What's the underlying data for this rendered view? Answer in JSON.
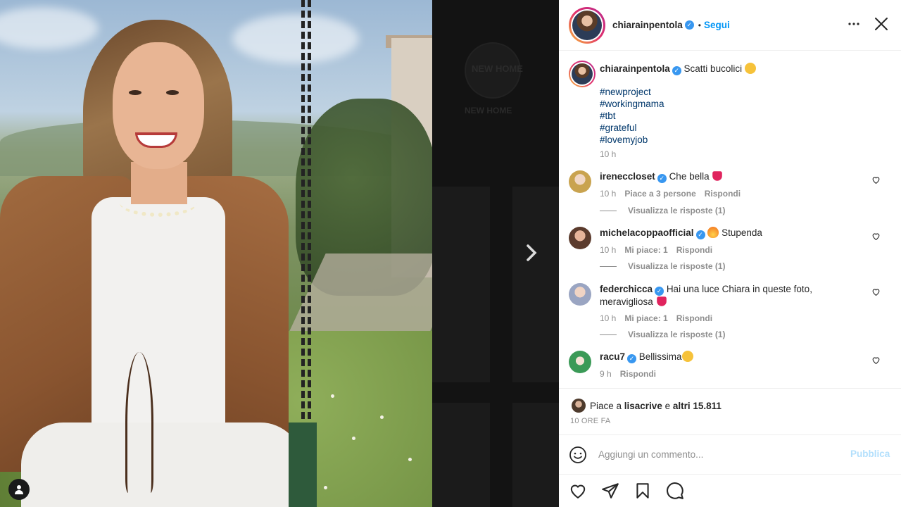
{
  "background": {
    "highlight_text": "NEW HOME",
    "highlight_label": "NEW HOME"
  },
  "header": {
    "username": "chiarainpentola",
    "verified": true,
    "separator": "•",
    "follow_label": "Segui",
    "more_icon": "ellipsis-icon",
    "close_icon": "close-icon"
  },
  "caption": {
    "username": "chiarainpentola",
    "text": "Scatti bucolici",
    "emoji": "star-struck",
    "hashtags": [
      "#newproject",
      "#workingmama",
      "#tbt",
      "#grateful",
      "#lovemyjob"
    ],
    "time": "10 h"
  },
  "comments": [
    {
      "username": "ireneccloset",
      "verified": true,
      "text": "Che bella",
      "emoji": "red-heart",
      "time": "10 h",
      "likes": "Piace a 3 persone",
      "reply_label": "Rispondi",
      "view_replies": "Visualizza le risposte (1)"
    },
    {
      "username": "michelacoppaofficial",
      "verified": true,
      "emoji": "fire",
      "text": "Stupenda",
      "time": "10 h",
      "likes": "Mi piace: 1",
      "reply_label": "Rispondi",
      "view_replies": "Visualizza le risposte (1)"
    },
    {
      "username": "federchicca",
      "verified": true,
      "text_line1": "Hai una luce Chiara in queste foto,",
      "text_line2": "meravigliosa",
      "emoji": "red-heart",
      "time": "10 h",
      "likes": "Mi piace: 1",
      "reply_label": "Rispondi",
      "view_replies": "Visualizza le risposte (1)"
    },
    {
      "username": "racu7",
      "verified": true,
      "text": "Bellissima",
      "emoji": "heart-eyes",
      "time": "9 h",
      "reply_label": "Rispondi"
    }
  ],
  "likes": {
    "prefix": "Piace a ",
    "user": "lisacrive",
    "middle": " e ",
    "others": "altri 15.811"
  },
  "date": "10 ORE FA",
  "add_comment": {
    "placeholder": "Aggiungi un commento...",
    "publish_label": "Pubblica"
  },
  "actions": [
    "heart-icon",
    "share-icon",
    "bookmark-icon",
    "comment-icon"
  ],
  "colors": {
    "link_blue": "#0095f6",
    "hashtag": "#00376b",
    "verified": "#3897f0",
    "muted": "#8e8e8e",
    "publish_disabled": "#b2dffc"
  }
}
